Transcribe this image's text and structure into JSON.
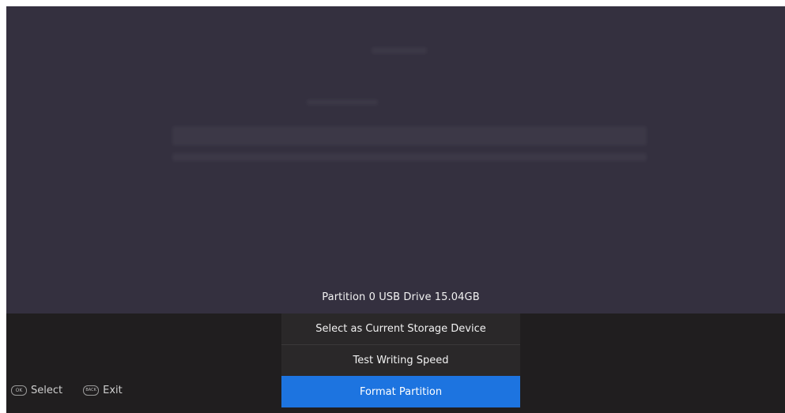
{
  "menu": {
    "header": "Partition 0  USB Drive  15.04GB",
    "items": [
      {
        "label": "Select as Current Storage Device",
        "selected": false
      },
      {
        "label": "Test Writing Speed",
        "selected": false
      },
      {
        "label": "Format Partition",
        "selected": true
      }
    ]
  },
  "legend": {
    "select": {
      "key": "OK",
      "label": "Select"
    },
    "exit": {
      "key": "BACK",
      "label": "Exit"
    }
  },
  "colors": {
    "background": "#34303f",
    "bottom_bar": "#201e1f",
    "menu_item": "#2a2829",
    "highlight": "#1d74e0"
  },
  "icons": [
    "ok-key-icon",
    "back-key-icon"
  ]
}
